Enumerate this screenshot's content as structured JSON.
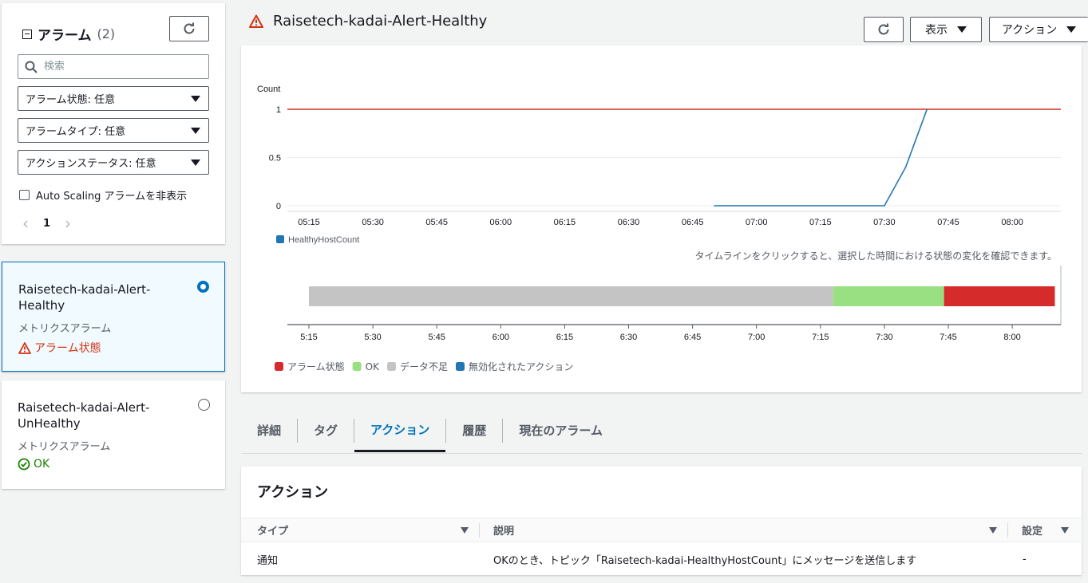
{
  "filter_panel": {
    "title": "アラーム",
    "count": "(2)",
    "search_placeholder": "検索",
    "state_select": "アラーム状態: 任意",
    "type_select": "アラームタイプ: 任意",
    "action_status_select": "アクションステータス: 任意",
    "hide_autoscaling_label": "Auto Scaling アラームを非表示",
    "page": "1"
  },
  "alarm_list": [
    {
      "name": "Raisetech-kadai-Alert-Healthy",
      "kind": "メトリクスアラーム",
      "state": "アラーム状態",
      "selected": true
    },
    {
      "name": "Raisetech-kadai-Alert-UnHealthy",
      "kind": "メトリクスアラーム",
      "state": "OK",
      "selected": false
    }
  ],
  "header": {
    "alarm_name": "Raisetech-kadai-Alert-Healthy",
    "display_button": "表示",
    "actions_button": "アクション"
  },
  "colors": {
    "alarm": "#d62b2b",
    "ok": "#98e082",
    "insufficient": "#c4c4c4",
    "metric_line": "#1f77b4",
    "accent": "#0073bb"
  },
  "chart_data": {
    "type": "line",
    "ylabel": "Count",
    "ylim": [
      0,
      1
    ],
    "y_ticks": [
      "1",
      "0.5",
      "0"
    ],
    "x_ticks": [
      "05:15",
      "05:30",
      "05:45",
      "06:00",
      "06:15",
      "06:30",
      "06:45",
      "07:00",
      "07:15",
      "07:30",
      "07:45",
      "08:00"
    ],
    "series": [
      {
        "name": "HealthyHostCount",
        "points": [
          [
            "06:50",
            0
          ],
          [
            "07:30",
            0
          ],
          [
            "07:35",
            0.4
          ],
          [
            "07:40",
            1
          ]
        ]
      }
    ],
    "threshold": 1
  },
  "timeline": {
    "hint": "タイムラインをクリックすると、選択した時間における状態の変化を確認できます。",
    "x_ticks": [
      "5:15",
      "5:30",
      "5:45",
      "6:00",
      "6:15",
      "6:30",
      "6:45",
      "7:00",
      "7:15",
      "7:30",
      "7:45",
      "8:00"
    ],
    "segments": [
      {
        "state": "insufficient",
        "from": "05:15",
        "to": "07:18"
      },
      {
        "state": "ok",
        "from": "07:18",
        "to": "07:44"
      },
      {
        "state": "alarm",
        "from": "07:44",
        "to": "08:10"
      }
    ],
    "legend": [
      {
        "label": "アラーム状態",
        "state": "alarm"
      },
      {
        "label": "OK",
        "state": "ok"
      },
      {
        "label": "データ不足",
        "state": "insufficient"
      },
      {
        "label": "無効化されたアクション",
        "state": "disabled"
      }
    ]
  },
  "tabs": [
    "詳細",
    "タグ",
    "アクション",
    "履歴",
    "現在のアラーム"
  ],
  "active_tab": "アクション",
  "actions": {
    "title": "アクション",
    "columns": [
      "タイプ",
      "説明",
      "設定"
    ],
    "rows": [
      [
        "通知",
        "OKのとき、トピック「Raisetech-kadai-HealthyHostCount」にメッセージを送信します",
        "-"
      ]
    ]
  }
}
